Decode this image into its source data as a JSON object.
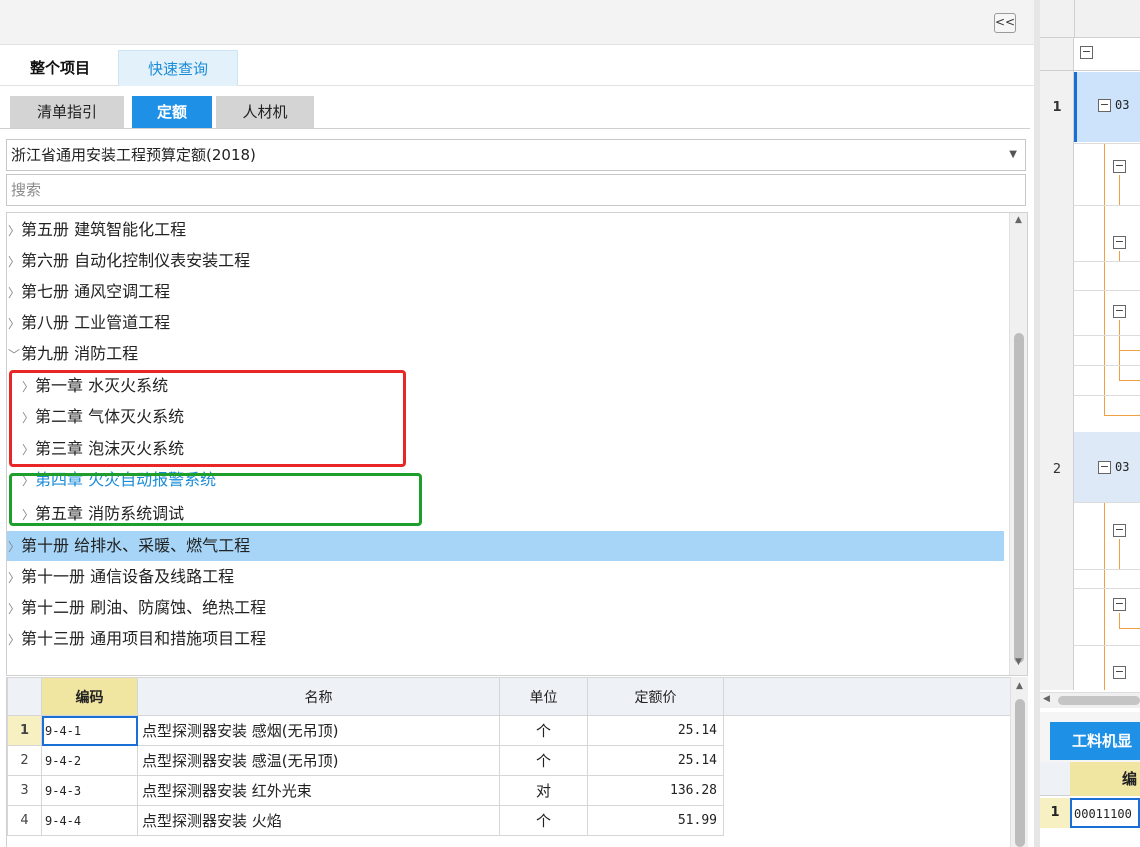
{
  "toolbar": {
    "collapse_label": "<<"
  },
  "scope_tabs": {
    "whole": "整个项目",
    "quick": "快速查询"
  },
  "type_tabs": {
    "list": "清单指引",
    "quota": "定额",
    "rcj": "人材机"
  },
  "library": {
    "selected": "浙江省通用安装工程预算定额(2018)"
  },
  "search": {
    "placeholder": "搜索"
  },
  "tree": [
    {
      "label": "第五册 建筑智能化工程",
      "expanded": false
    },
    {
      "label": "第六册 自动化控制仪表安装工程",
      "expanded": false
    },
    {
      "label": "第七册 通风空调工程",
      "expanded": false
    },
    {
      "label": "第八册 工业管道工程",
      "expanded": false
    },
    {
      "label": "第九册 消防工程",
      "expanded": true
    },
    {
      "label": "第一章 水灭火系统",
      "child": true
    },
    {
      "label": "第二章 气体灭火系统",
      "child": true
    },
    {
      "label": "第三章 泡沫灭火系统",
      "child": true
    },
    {
      "label": "第四章 火灾自动报警系统",
      "child": true,
      "active": true
    },
    {
      "label": "第五章 消防系统调试",
      "child": true
    },
    {
      "label": "第十册 给排水、采暖、燃气工程",
      "selected": true
    },
    {
      "label": "第十一册 通信设备及线路工程"
    },
    {
      "label": "第十二册 刷油、防腐蚀、绝热工程"
    },
    {
      "label": "第十三册 通用项目和措施项目工程"
    }
  ],
  "highlight_colors": {
    "red": "#e82626",
    "green": "#1e9e2a",
    "selection": "#a6d5f7",
    "accent": "#1e90e6"
  },
  "quota_table": {
    "headers": {
      "code": "编码",
      "name": "名称",
      "unit": "单位",
      "price": "定额价"
    },
    "rows": [
      {
        "no": "1",
        "code": "9-4-1",
        "name": "点型探测器安装 感烟(无吊顶)",
        "unit": "个",
        "price": "25.14"
      },
      {
        "no": "2",
        "code": "9-4-2",
        "name": "点型探测器安装 感温(无吊顶)",
        "unit": "个",
        "price": "25.14"
      },
      {
        "no": "3",
        "code": "9-4-3",
        "name": "点型探测器安装 红外光束",
        "unit": "对",
        "price": "136.28"
      },
      {
        "no": "4",
        "code": "9-4-4",
        "name": "点型探测器安装 火焰",
        "unit": "个",
        "price": "51.99"
      }
    ]
  },
  "right_panel": {
    "row1_num": "1",
    "row1_code": "03",
    "row2_num": "2",
    "row2_code": "03",
    "bottom_tab": "工料机显",
    "grid_header": "编",
    "grid_row_num": "1",
    "grid_row_code": "00011100"
  }
}
